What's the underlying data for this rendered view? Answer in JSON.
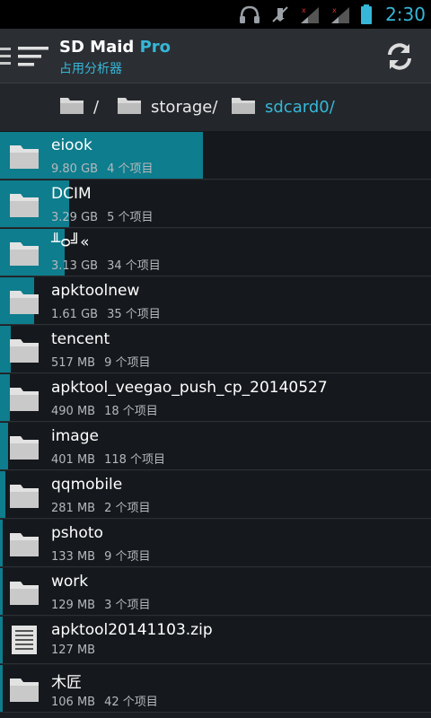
{
  "status_bar": {
    "time": "2:30",
    "icons": [
      "headset-icon",
      "mute-icon",
      "signal-icon",
      "signal-icon",
      "battery-icon"
    ]
  },
  "action_bar": {
    "title_main": "SD Maid ",
    "title_pro": "Pro",
    "subtitle": "占用分析器",
    "menu_icon": "hamburger-icon",
    "refresh_icon": "refresh-icon"
  },
  "breadcrumb": [
    {
      "label": "/",
      "icon": "folder-icon"
    },
    {
      "label": "storage/",
      "icon": "folder-icon"
    },
    {
      "label": "sdcard0/",
      "icon": "folder-icon",
      "active": true
    }
  ],
  "items": [
    {
      "name": "eiook",
      "size": "9.80 GB",
      "count": "4 个项目",
      "type": "folder",
      "fraction": 0.47
    },
    {
      "name": "DCIM",
      "size": "3.29 GB",
      "count": "5 个项目",
      "type": "folder",
      "fraction": 0.16
    },
    {
      "name": "╨ᴑ╝«",
      "size": "3.13 GB",
      "count": "34 个项目",
      "type": "folder",
      "fraction": 0.15
    },
    {
      "name": "apktoolnew",
      "size": "1.61 GB",
      "count": "35 个项目",
      "type": "folder",
      "fraction": 0.08
    },
    {
      "name": "tencent",
      "size": "517 MB",
      "count": "9 个项目",
      "type": "folder",
      "fraction": 0.025
    },
    {
      "name": "apktool_veegao_push_cp_20140527",
      "size": "490 MB",
      "count": "18 个项目",
      "type": "folder",
      "fraction": 0.023
    },
    {
      "name": "image",
      "size": "401 MB",
      "count": "118 个项目",
      "type": "folder",
      "fraction": 0.019
    },
    {
      "name": "qqmobile",
      "size": "281 MB",
      "count": "2 个项目",
      "type": "folder",
      "fraction": 0.013
    },
    {
      "name": "pshoto",
      "size": "133 MB",
      "count": "9 个项目",
      "type": "folder",
      "fraction": 0.006
    },
    {
      "name": "work",
      "size": "129 MB",
      "count": "3 个项目",
      "type": "folder",
      "fraction": 0.006
    },
    {
      "name": "apktool20141103.zip",
      "size": "127 MB",
      "count": "",
      "type": "file",
      "fraction": 0.006
    },
    {
      "name": "木匠",
      "size": "106 MB",
      "count": "42 个项目",
      "type": "folder",
      "fraction": 0.005
    }
  ],
  "colors": {
    "accent": "#36b7d8",
    "bar": "#0e7d8d",
    "row_bg": "#15191d",
    "icon": "#d9d9d9"
  }
}
